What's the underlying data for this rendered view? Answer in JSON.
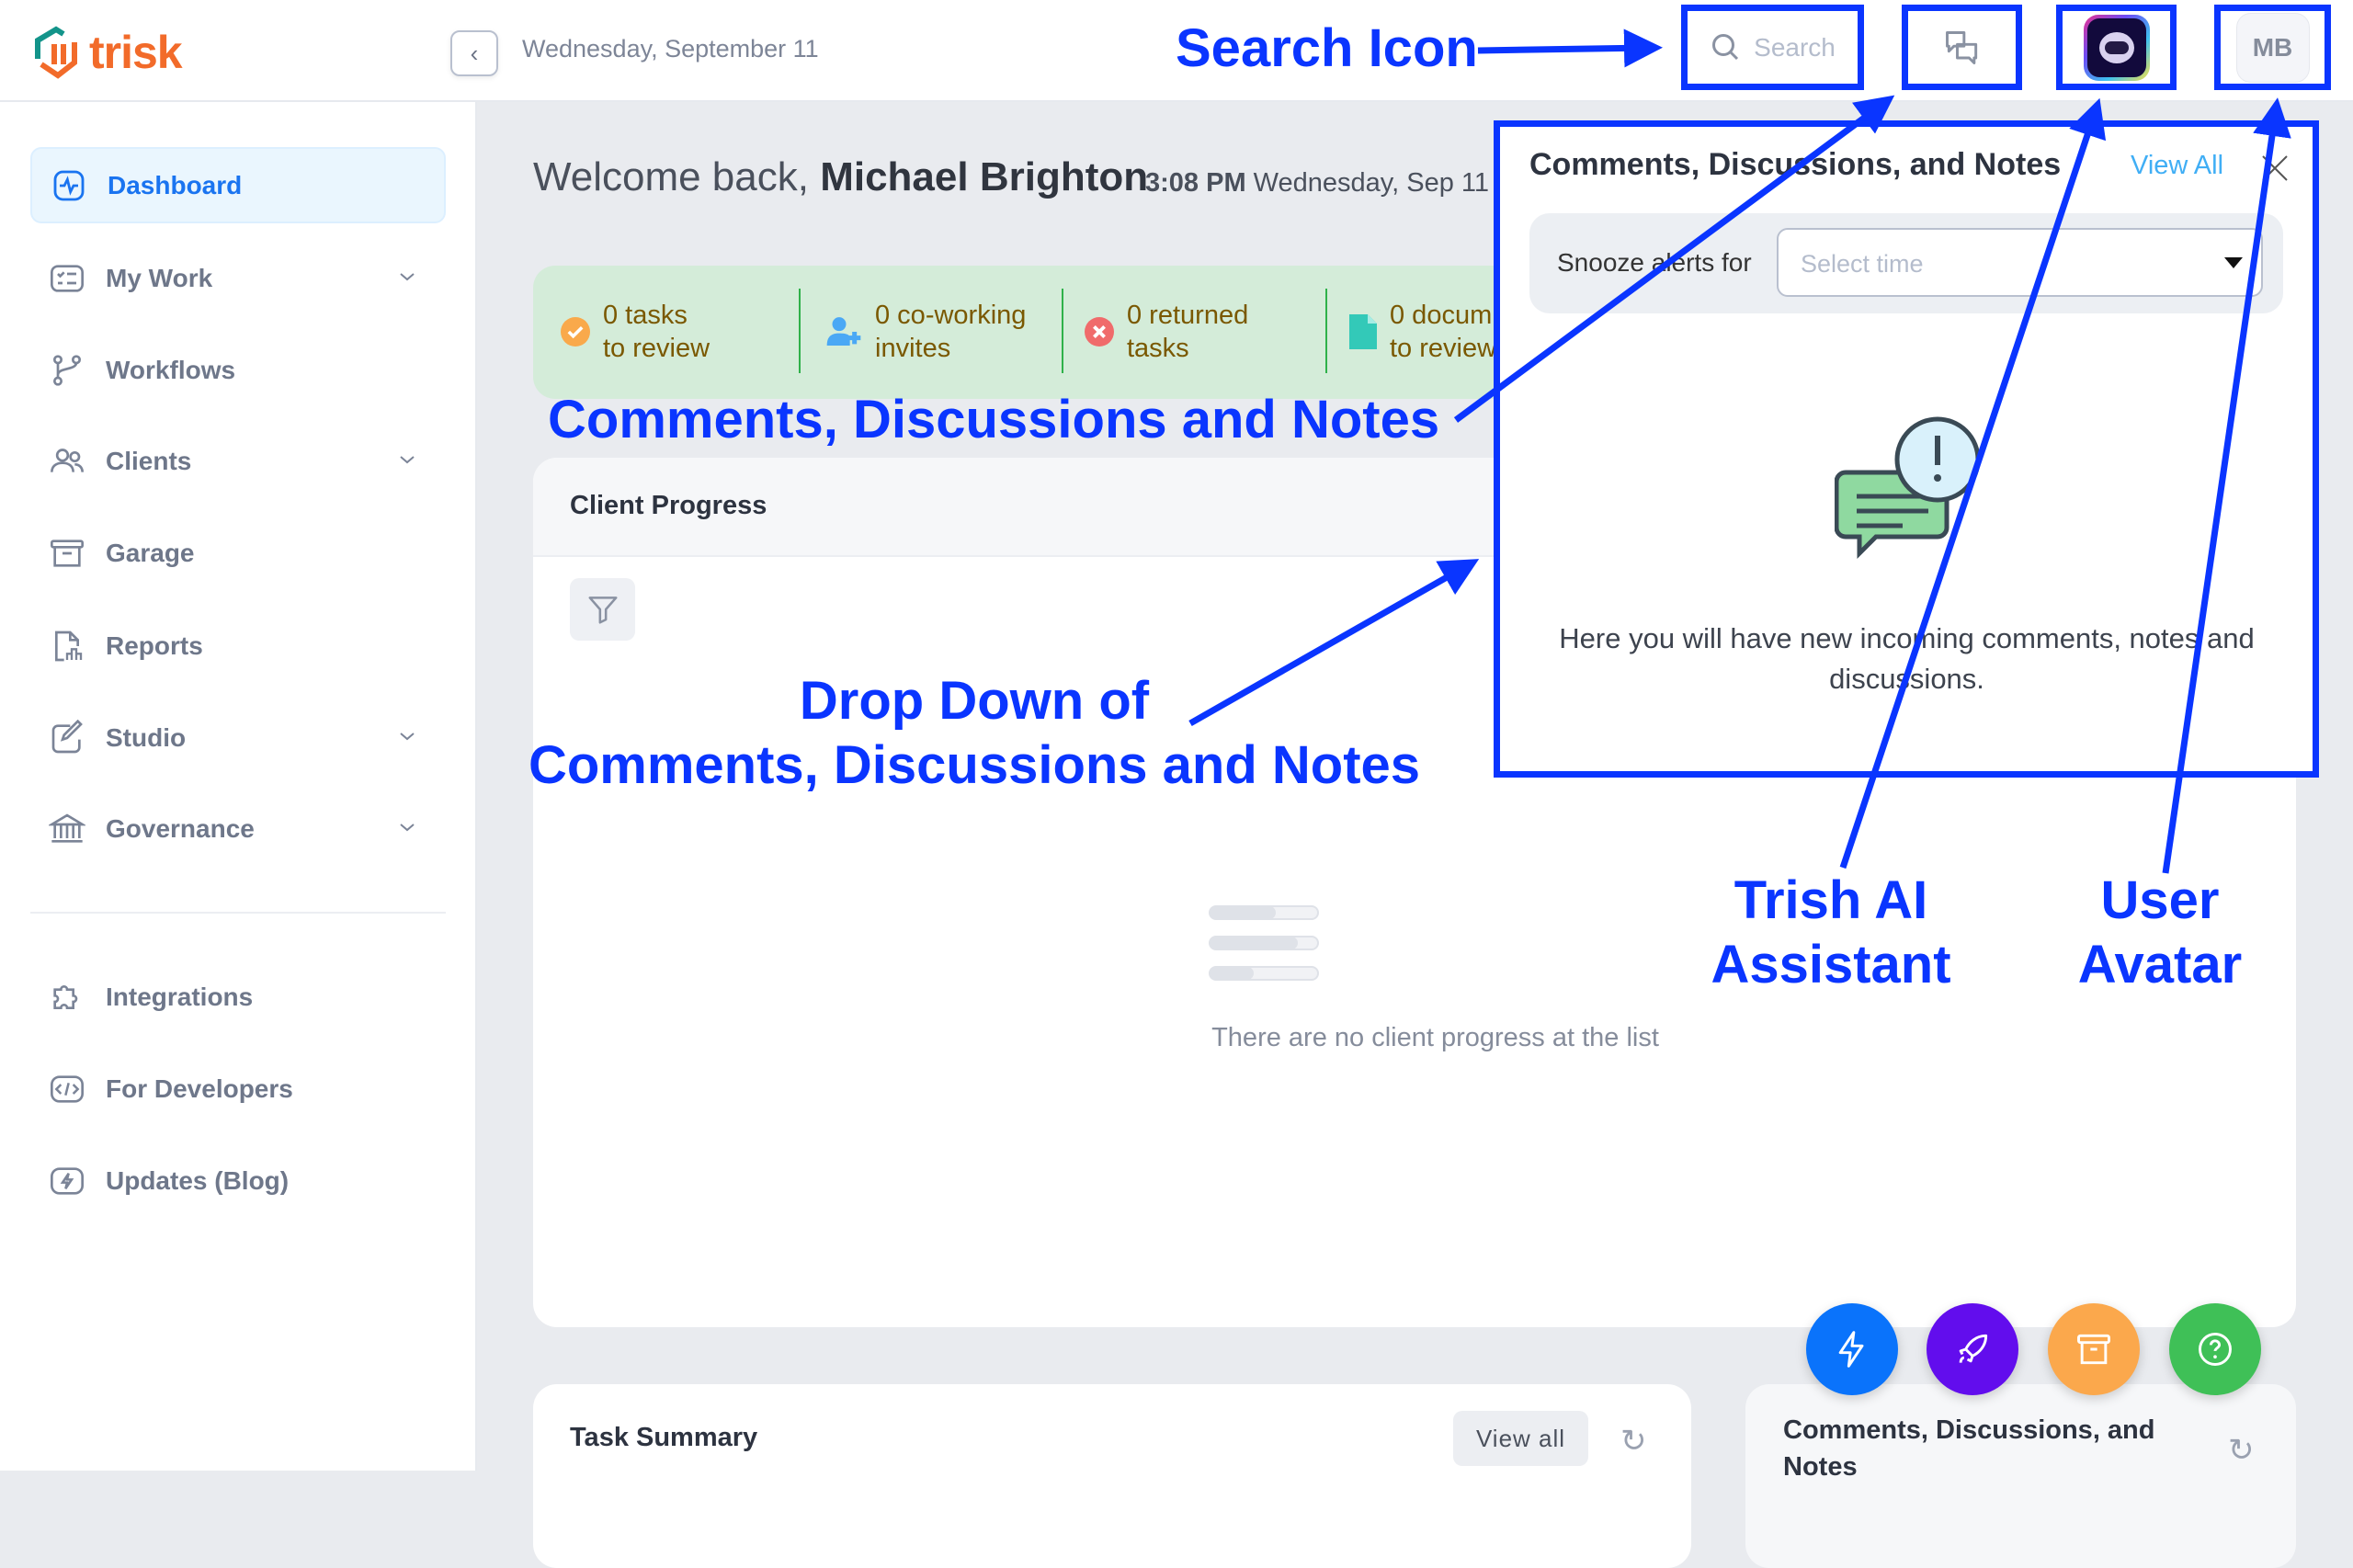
{
  "header": {
    "logo_text": "trisk",
    "date": "Wednesday, September 11",
    "search_placeholder": "Search",
    "avatar_initials": "MB"
  },
  "sidebar": {
    "items": [
      {
        "label": "Dashboard",
        "icon": "activity-icon",
        "active": true
      },
      {
        "label": "My Work",
        "icon": "checklist-icon",
        "expandable": true
      },
      {
        "label": "Workflows",
        "icon": "git-branch-icon"
      },
      {
        "label": "Clients",
        "icon": "users-icon",
        "expandable": true
      },
      {
        "label": "Garage",
        "icon": "archive-icon"
      },
      {
        "label": "Reports",
        "icon": "report-icon"
      },
      {
        "label": "Studio",
        "icon": "brush-icon",
        "expandable": true
      },
      {
        "label": "Governance",
        "icon": "bank-icon",
        "expandable": true
      },
      {
        "label": "Integrations",
        "icon": "puzzle-icon"
      },
      {
        "label": "For Developers",
        "icon": "code-icon"
      },
      {
        "label": "Updates (Blog)",
        "icon": "bolt-icon"
      }
    ]
  },
  "main": {
    "welcome_prefix": "Welcome back, ",
    "user_name": "Michael Brighton",
    "time": "3:08 PM",
    "time_date": "Wednesday, Sep 11",
    "stats": [
      {
        "line1": "0 tasks",
        "line2": "to review",
        "icon": "check-circle-icon",
        "color": "#f9a94b"
      },
      {
        "line1": "0 co-working",
        "line2": "invites",
        "icon": "user-plus-icon",
        "color": "#4aa8f5"
      },
      {
        "line1": "0 returned",
        "line2": "tasks",
        "icon": "x-circle-icon",
        "color": "#f06b6b"
      },
      {
        "line1": "0 docum",
        "line2": "to review",
        "icon": "file-icon",
        "color": "#33c9b8"
      }
    ],
    "client_progress": {
      "title": "Client Progress",
      "empty_text": "There are no client progress at the list"
    },
    "task_summary": {
      "title": "Task Summary",
      "view_all": "View all"
    },
    "comments_card": {
      "title": "Comments, Discussions, and Notes"
    }
  },
  "panel": {
    "title": "Comments, Discussions, and Notes",
    "view_all": "View All",
    "snooze_label": "Snooze alerts for",
    "select_placeholder": "Select time",
    "empty_text": "Here you will have new incoming comments, notes and discussions."
  },
  "fabs": [
    {
      "icon": "bolt-icon",
      "color": "#0a73fb"
    },
    {
      "icon": "rocket-icon",
      "color": "#620ded"
    },
    {
      "icon": "archive-icon",
      "color": "#fba84c"
    },
    {
      "icon": "help-circle-icon",
      "color": "#3fc057"
    }
  ],
  "annotations": {
    "search": "Search Icon",
    "comments": "Comments, Discussions and Notes",
    "dropdown_1": "Drop Down of",
    "dropdown_2": "Comments, Discussions and Notes",
    "trish_1": "Trish AI",
    "trish_2": "Assistant",
    "user_1": "User",
    "user_2": "Avatar",
    "color": "#0a35ff"
  }
}
